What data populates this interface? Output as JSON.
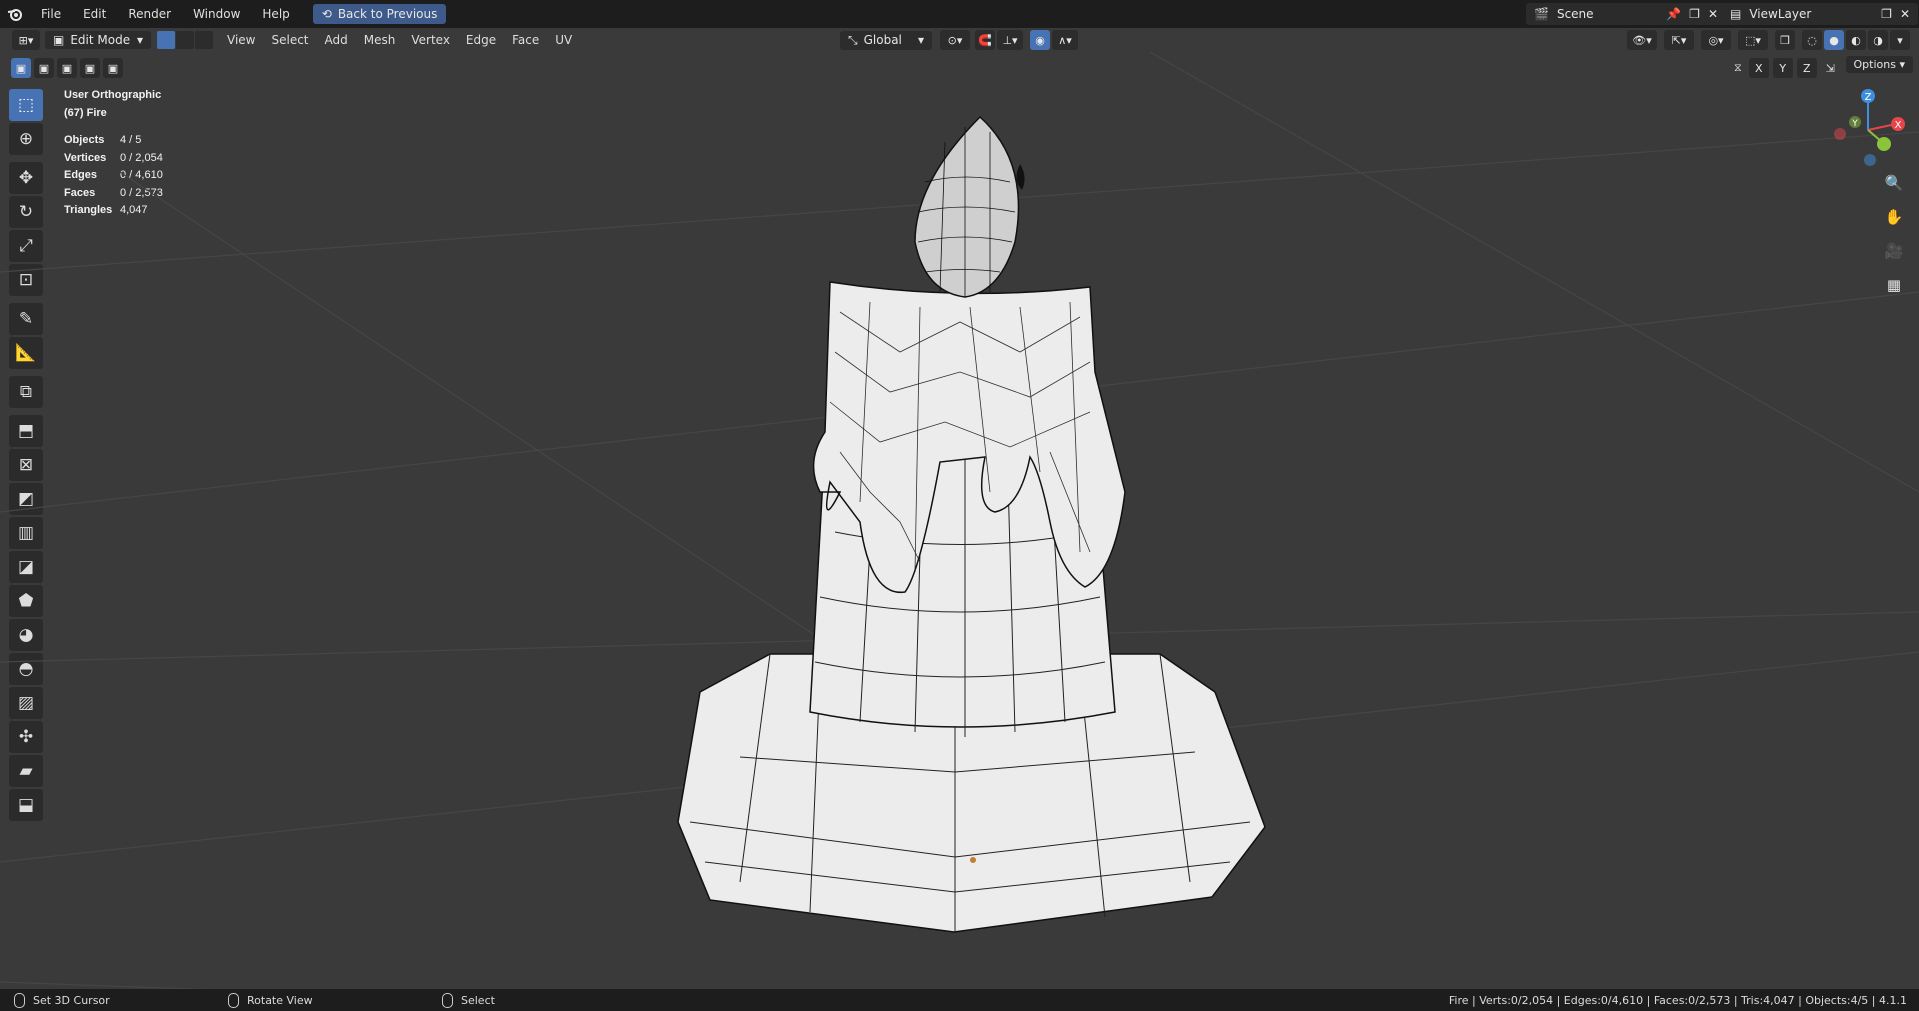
{
  "topbar": {
    "menus": [
      "File",
      "Edit",
      "Render",
      "Window",
      "Help"
    ],
    "back_label": "Back to Previous",
    "scene": "Scene",
    "view_layer": "ViewLayer"
  },
  "header": {
    "mode": "Edit Mode",
    "menus": [
      "View",
      "Select",
      "Add",
      "Mesh",
      "Vertex",
      "Edge",
      "Face",
      "UV"
    ],
    "orientation": "Global",
    "axes": [
      "X",
      "Y",
      "Z"
    ],
    "options_label": "Options"
  },
  "overlay": {
    "view_name": "User Orthographic",
    "object_name": "(67) Fire",
    "stats": [
      {
        "label": "Objects",
        "value": "4 / 5"
      },
      {
        "label": "Vertices",
        "value": "0 / 2,054"
      },
      {
        "label": "Edges",
        "value": "0 / 4,610"
      },
      {
        "label": "Faces",
        "value": "0 / 2,573"
      },
      {
        "label": "Triangles",
        "value": "4,047"
      }
    ]
  },
  "gizmo": {
    "x": "X",
    "y": "Y",
    "z": "Z"
  },
  "status": {
    "left_click": "Set 3D Cursor",
    "middle_click": "Rotate View",
    "right_click": "Select",
    "summary": "Fire | Verts:0/2,054 | Edges:0/4,610 | Faces:0/2,573 | Tris:4,047 | Objects:4/5 | 4.1.1"
  },
  "colors": {
    "accent": "#4772b3",
    "gizmo_x": "#e8454a",
    "gizmo_y": "#8bc43b",
    "gizmo_z": "#3f8fe0"
  }
}
